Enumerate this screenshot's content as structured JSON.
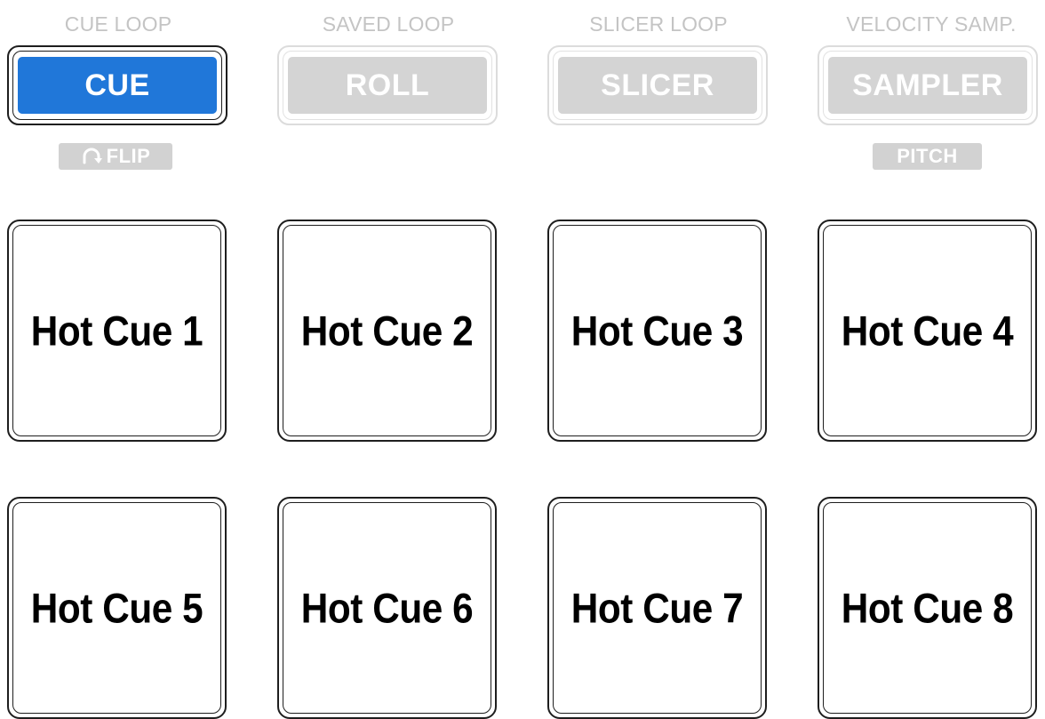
{
  "modes": [
    {
      "caption": "CUE LOOP",
      "label": "CUE",
      "active": true
    },
    {
      "caption": "SAVED LOOP",
      "label": "ROLL",
      "active": false
    },
    {
      "caption": "SLICER LOOP",
      "label": "SLICER",
      "active": false
    },
    {
      "caption": "VELOCITY SAMP.",
      "label": "SAMPLER",
      "active": false
    }
  ],
  "shift_labels": {
    "cue": {
      "text": "FLIP",
      "icon": "flip-icon"
    },
    "sampler": {
      "text": "PITCH"
    }
  },
  "pads": [
    {
      "label": "Hot Cue 1"
    },
    {
      "label": "Hot Cue 2"
    },
    {
      "label": "Hot Cue 3"
    },
    {
      "label": "Hot Cue 4"
    },
    {
      "label": "Hot Cue 5"
    },
    {
      "label": "Hot Cue 6"
    },
    {
      "label": "Hot Cue 7"
    },
    {
      "label": "Hot Cue 8"
    }
  ],
  "colors": {
    "active_mode": "#2077d9",
    "inactive_mode": "#d4d4d4",
    "caption_text": "#c4c4c4",
    "pad_outline": "#1e1e1e"
  }
}
